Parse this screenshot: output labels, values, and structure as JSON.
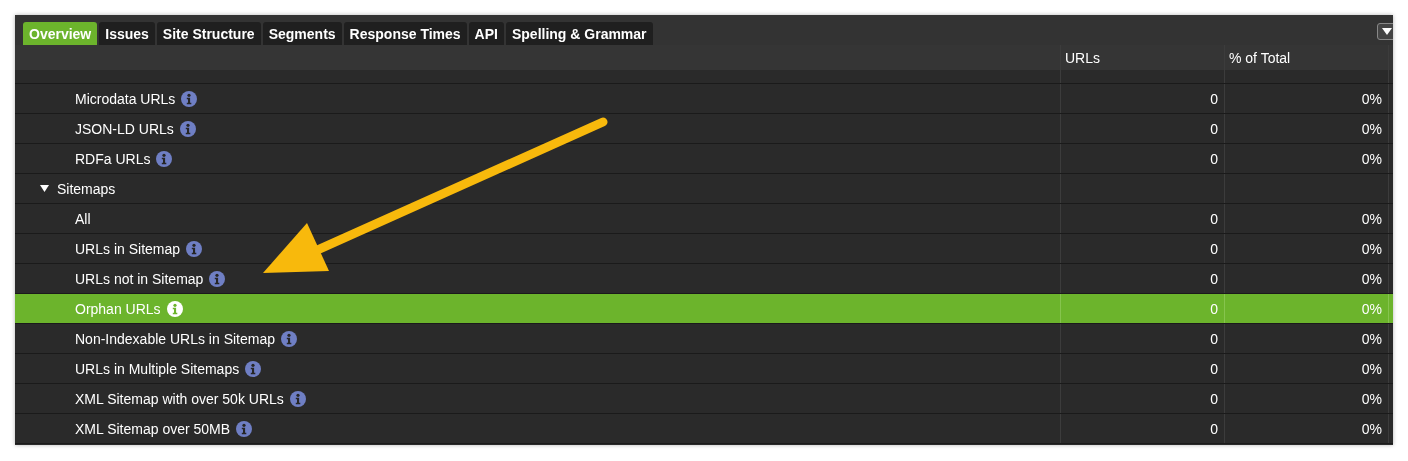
{
  "tabs": [
    {
      "label": "Overview",
      "selected": true
    },
    {
      "label": "Issues",
      "selected": false
    },
    {
      "label": "Site Structure",
      "selected": false
    },
    {
      "label": "Segments",
      "selected": false
    },
    {
      "label": "Response Times",
      "selected": false
    },
    {
      "label": "API",
      "selected": false
    },
    {
      "label": "Spelling & Grammar",
      "selected": false
    }
  ],
  "table": {
    "columns": [
      "URLs",
      "% of Total"
    ],
    "rows": [
      {
        "kind": "item",
        "label": "Microdata URLs",
        "info": true,
        "urls": "0",
        "percent": "0%",
        "selected": false
      },
      {
        "kind": "item",
        "label": "JSON-LD URLs",
        "info": true,
        "urls": "0",
        "percent": "0%",
        "selected": false
      },
      {
        "kind": "item",
        "label": "RDFa URLs",
        "info": true,
        "urls": "0",
        "percent": "0%",
        "selected": false
      },
      {
        "kind": "group",
        "label": "Sitemaps",
        "expanded": true,
        "selected": false
      },
      {
        "kind": "item",
        "label": "All",
        "info": false,
        "urls": "0",
        "percent": "0%",
        "selected": false
      },
      {
        "kind": "item",
        "label": "URLs in Sitemap",
        "info": true,
        "urls": "0",
        "percent": "0%",
        "selected": false
      },
      {
        "kind": "item",
        "label": "URLs not in Sitemap",
        "info": true,
        "urls": "0",
        "percent": "0%",
        "selected": false
      },
      {
        "kind": "item",
        "label": "Orphan URLs",
        "info": true,
        "urls": "0",
        "percent": "0%",
        "selected": true
      },
      {
        "kind": "item",
        "label": "Non-Indexable URLs in Sitemap",
        "info": true,
        "urls": "0",
        "percent": "0%",
        "selected": false
      },
      {
        "kind": "item",
        "label": "URLs in Multiple Sitemaps",
        "info": true,
        "urls": "0",
        "percent": "0%",
        "selected": false
      },
      {
        "kind": "item",
        "label": "XML Sitemap with over 50k URLs",
        "info": true,
        "urls": "0",
        "percent": "0%",
        "selected": false
      },
      {
        "kind": "item",
        "label": "XML Sitemap over 50MB",
        "info": true,
        "urls": "0",
        "percent": "0%",
        "selected": false
      }
    ]
  }
}
